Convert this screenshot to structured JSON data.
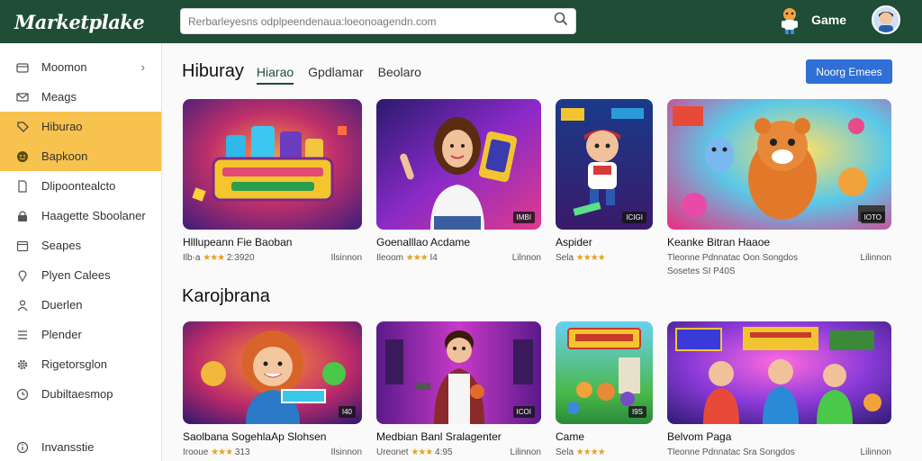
{
  "header": {
    "logo": "Marketplake",
    "search_placeholder": "Rerbarleyesns odplpeendenaua:loeonoagendn.com",
    "user_label": "Game"
  },
  "sidebar": {
    "items": [
      {
        "label": "Moomon",
        "icon": "wallet-icon"
      },
      {
        "label": "Meags",
        "icon": "mail-icon"
      },
      {
        "label": "Hiburao",
        "icon": "tag-icon"
      },
      {
        "label": "Bapkoon",
        "icon": "smile-icon"
      },
      {
        "label": "Dlipoontealcto",
        "icon": "document-icon"
      },
      {
        "label": "Haagette Sboolaner",
        "icon": "lock-icon"
      },
      {
        "label": "Seapes",
        "icon": "calendar-icon"
      },
      {
        "label": "Plyen Calees",
        "icon": "pin-icon"
      },
      {
        "label": "Duerlen",
        "icon": "users-icon"
      },
      {
        "label": "Plender",
        "icon": "list-icon"
      },
      {
        "label": "Rigetorsglon",
        "icon": "gear-icon"
      },
      {
        "label": "Dubiltaesmop",
        "icon": "clock-icon"
      }
    ],
    "bottom_item": {
      "label": "Invansstie",
      "icon": "info-icon"
    }
  },
  "main": {
    "title": "Hiburay",
    "tabs": [
      "Hiarao",
      "Gpdlamar",
      "Beolaro"
    ],
    "cta_label": "Noorg Emees",
    "section2_title": "Karojbrana"
  },
  "cards_row1": [
    {
      "title": "Hlllupeann Fie Baoban",
      "meta_left": "Ilb·a",
      "rating": "★★★",
      "rating_text": "2:3920",
      "meta_right": "Ilsinnon",
      "badge": ""
    },
    {
      "title": "Goenalllao Acdame",
      "meta_left": "Ileoom",
      "rating": "★★★",
      "rating_text": "I4",
      "meta_right": "Lilnnon",
      "badge": "IMBI"
    },
    {
      "title": "Aspider",
      "meta_left": "Sela",
      "rating": "★★★★",
      "rating_text": "",
      "meta_right": "",
      "badge": "ICIGI"
    },
    {
      "title": "Keanke Bitran Haaoe",
      "meta_left": "Tleonne Pdnnatac Oon Songdos",
      "rating": "",
      "rating_text": "",
      "meta_right": "Lilinnon",
      "extra": "Sosetes SI P40S",
      "badge": "IOTO"
    }
  ],
  "cards_row2": [
    {
      "title": "Saolbana SogehlaAp Slohsen",
      "meta_left": "Irooue",
      "rating": "★★★",
      "rating_text": "313",
      "meta_right": "Ilsinnon",
      "badge": "I40"
    },
    {
      "title": "Medbian Banl Sralagenter",
      "meta_left": "Ureonet",
      "rating": "★★★",
      "rating_text": "4:95",
      "meta_right": "Lilinnon",
      "badge": "ICOI"
    },
    {
      "title": "Came",
      "meta_left": "Sela",
      "rating": "★★★★",
      "rating_text": "",
      "meta_right": "",
      "badge": "I9S"
    },
    {
      "title": "Belvom Paga",
      "meta_left": "Tleonne Pdnnatac Sra Songdos",
      "rating": "",
      "rating_text": "",
      "meta_right": "Lilinnon",
      "badge": ""
    }
  ],
  "colors": {
    "header": "#1f4d36",
    "active": "#f7c24e",
    "cta": "#2f6fd6",
    "star": "#e8a21c"
  }
}
